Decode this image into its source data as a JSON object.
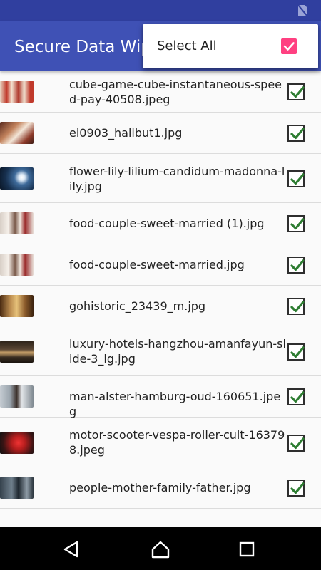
{
  "app": {
    "title": "Secure Data Wipe"
  },
  "menu": {
    "select_all_label": "Select All",
    "select_all_checked": true
  },
  "files": [
    {
      "name": "cube-game-cube-instantaneous-speed-pay-40508.jpeg",
      "checked": true
    },
    {
      "name": "ei0903_halibut1.jpg",
      "checked": true
    },
    {
      "name": "flower-lily-lilium-candidum-madonna-lily.jpg",
      "checked": true
    },
    {
      "name": "food-couple-sweet-married (1).jpg",
      "checked": true
    },
    {
      "name": "food-couple-sweet-married.jpg",
      "checked": true
    },
    {
      "name": "gohistoric_23439_m.jpg",
      "checked": true
    },
    {
      "name": "luxury-hotels-hangzhou-amanfayun-slide-3_lg.jpg",
      "checked": true
    },
    {
      "name": "man-alster-hamburg-oud-160651.jpeg",
      "checked": true
    },
    {
      "name": "motor-scooter-vespa-roller-cult-163798.jpeg",
      "checked": true
    },
    {
      "name": "people-mother-family-father.jpg",
      "checked": true
    }
  ],
  "colors": {
    "status_bar": "#303f9f",
    "app_bar": "#3f51b5",
    "accent": "#ff4081",
    "check_mark": "#2e7d32"
  },
  "icons": {
    "status": "no-sim-icon",
    "nav_back": "back-triangle-icon",
    "nav_home": "home-icon",
    "nav_recents": "recents-square-icon"
  }
}
